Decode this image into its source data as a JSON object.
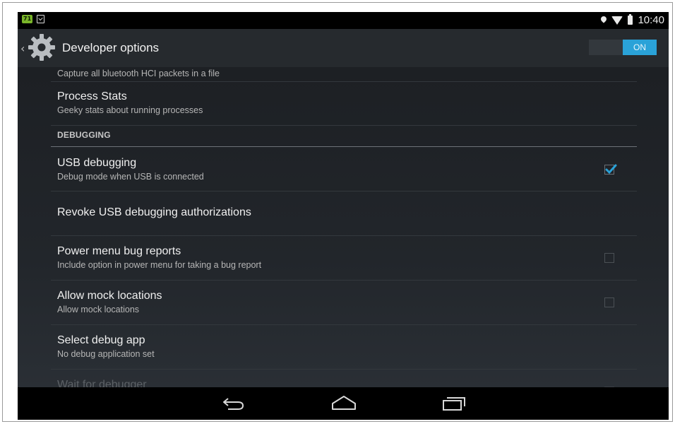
{
  "status_bar": {
    "notification_badge": "71",
    "clock": "10:40",
    "icons": [
      "clipboard-check-icon",
      "location-pin-icon",
      "wifi-icon",
      "battery-icon"
    ]
  },
  "action_bar": {
    "title": "Developer options",
    "toggle_off_label": "",
    "toggle_on_label": "ON",
    "toggle_state": "on"
  },
  "list": {
    "partial_top_summary": "Capture all bluetooth HCI packets in a file",
    "process_stats": {
      "title": "Process Stats",
      "summary": "Geeky stats about running processes"
    },
    "section_debugging": "DEBUGGING",
    "items": [
      {
        "title": "USB debugging",
        "summary": "Debug mode when USB is connected",
        "checked": true
      },
      {
        "title": "Revoke USB debugging authorizations",
        "summary": ""
      },
      {
        "title": "Power menu bug reports",
        "summary": "Include option in power menu for taking a bug report",
        "checked": false
      },
      {
        "title": "Allow mock locations",
        "summary": "Allow mock locations",
        "checked": false
      },
      {
        "title": "Select debug app",
        "summary": "No debug application set"
      },
      {
        "title": "Wait for debugger",
        "summary": "",
        "checked": false,
        "enabled": false
      }
    ]
  },
  "nav_bar": {
    "icons": [
      "back-icon",
      "home-icon",
      "recent-apps-icon"
    ]
  },
  "colors": {
    "accent": "#2aa2d8",
    "background": "#1a1d21",
    "action_bar": "#262a2e",
    "text_primary": "#f0f0f0",
    "text_secondary": "#b6b6b6"
  }
}
